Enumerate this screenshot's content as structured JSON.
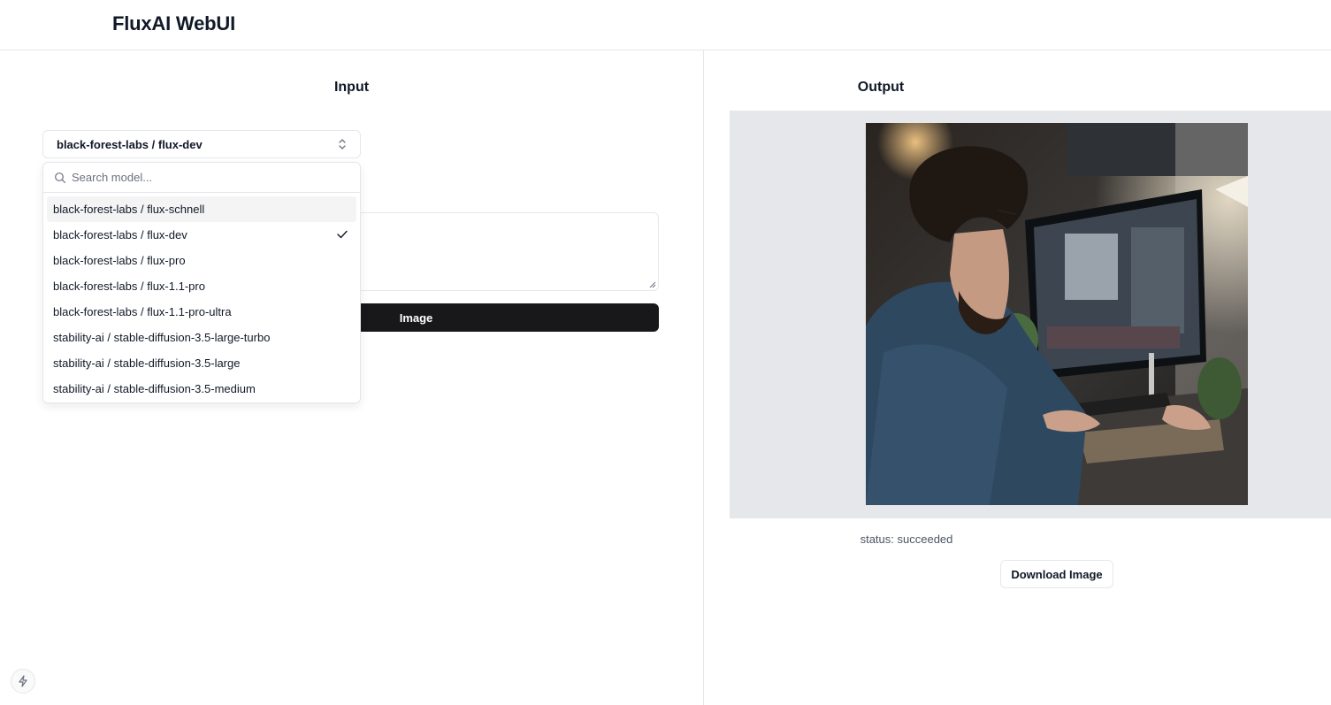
{
  "app": {
    "title": "FluxAI WebUI"
  },
  "input_panel": {
    "title": "Input",
    "model_select": {
      "selected": "black-forest-labs / flux-dev",
      "icon": "chevron-up-down-icon"
    },
    "generate_button": {
      "label": "Image"
    }
  },
  "dropdown": {
    "search": {
      "placeholder": "Search model...",
      "value": "",
      "icon": "search-icon"
    },
    "options": [
      {
        "label": "black-forest-labs / flux-schnell",
        "highlighted": true,
        "selected": false
      },
      {
        "label": "black-forest-labs / flux-dev",
        "highlighted": false,
        "selected": true
      },
      {
        "label": "black-forest-labs / flux-pro",
        "highlighted": false,
        "selected": false
      },
      {
        "label": "black-forest-labs / flux-1.1-pro",
        "highlighted": false,
        "selected": false
      },
      {
        "label": "black-forest-labs / flux-1.1-pro-ultra",
        "highlighted": false,
        "selected": false
      },
      {
        "label": "stability-ai / stable-diffusion-3.5-large-turbo",
        "highlighted": false,
        "selected": false
      },
      {
        "label": "stability-ai / stable-diffusion-3.5-large",
        "highlighted": false,
        "selected": false
      },
      {
        "label": "stability-ai / stable-diffusion-3.5-medium",
        "highlighted": false,
        "selected": false
      }
    ]
  },
  "output_panel": {
    "title": "Output",
    "status": "status: succeeded",
    "download_button": {
      "label": "Download Image"
    }
  },
  "colors": {
    "primary_button": "#18181b",
    "border": "#e5e7eb",
    "image_frame": "#e5e7eb",
    "highlight": "#f4f4f5"
  },
  "icons": {
    "corner_badge": "lightning-icon",
    "check": "check-icon"
  }
}
